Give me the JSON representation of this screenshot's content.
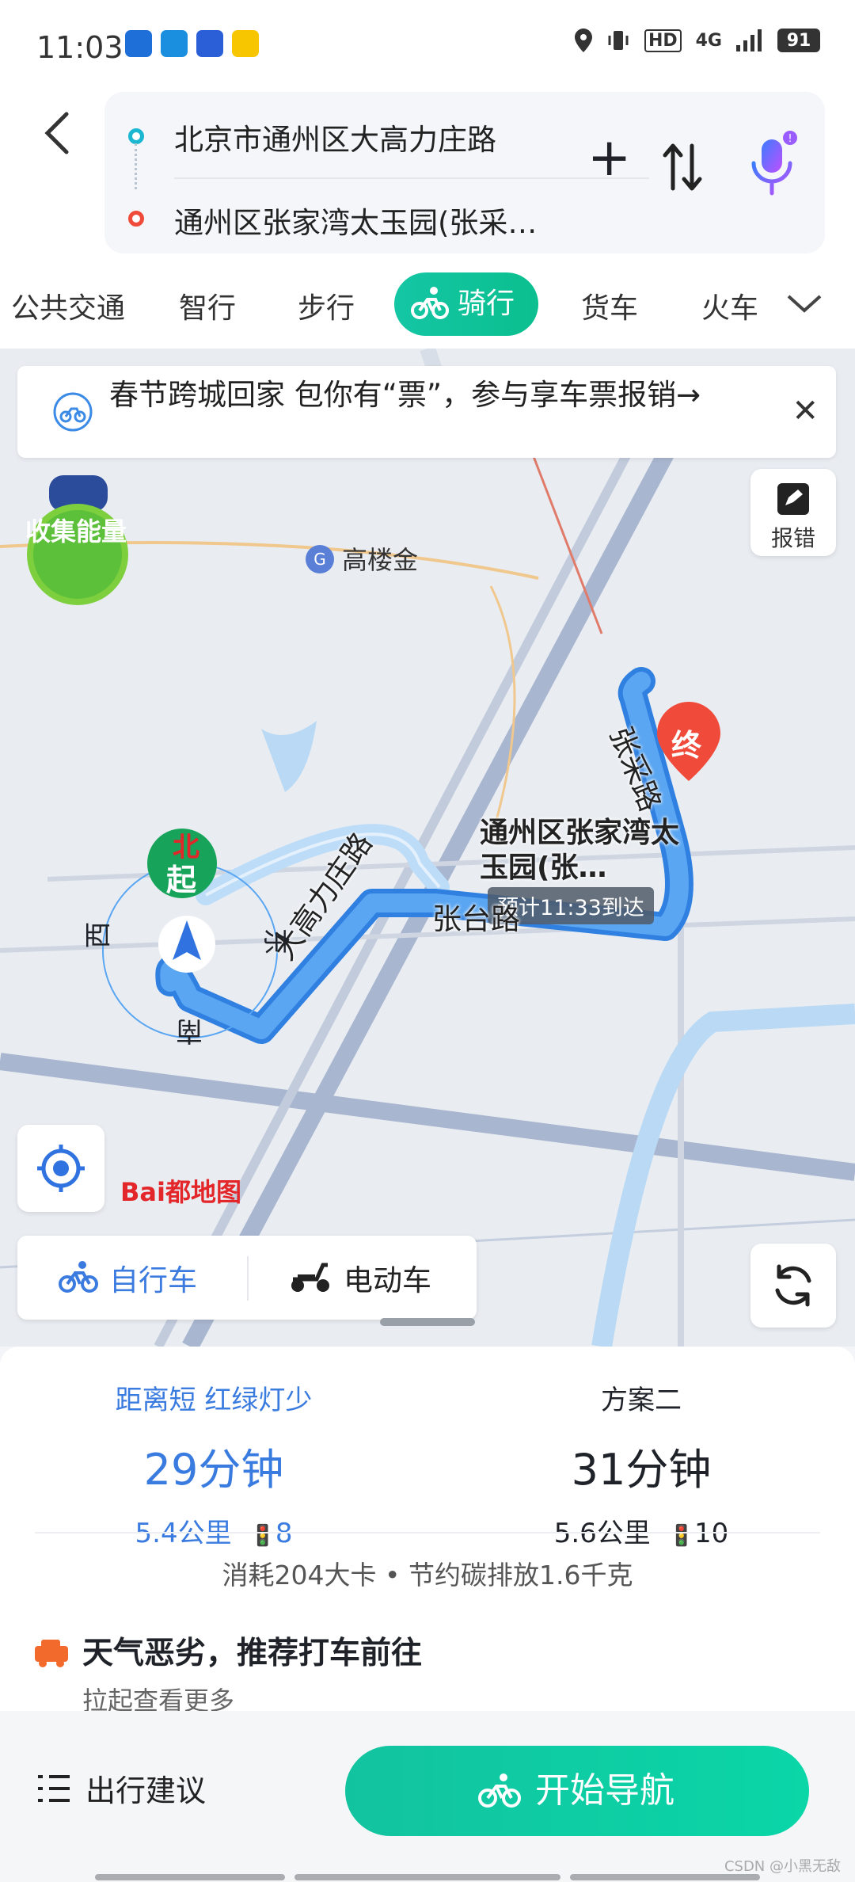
{
  "status_bar": {
    "time": "11:03",
    "battery": "91",
    "network": "4G",
    "hd_badge": "HD"
  },
  "route": {
    "start": "北京市通州区大高力庄路",
    "end": "通州区张家湾太玉园(张采…"
  },
  "tabs": [
    "公共交通",
    "智行",
    "步行",
    "骑行",
    "货车",
    "火车"
  ],
  "map": {
    "banner": "春节跨城回家 包你有“票”，参与享车票报销→",
    "feedback_label": "报错",
    "energy_label": "收集能量",
    "poi": "高楼金",
    "destination": "通州区张家湾太玉园(张…",
    "eta": "预计11:33到达",
    "roads": {
      "r1": "大高力庄路",
      "r2": "张台路",
      "r3": "张采路"
    },
    "compass": {
      "north": "北",
      "south": "南",
      "east": "东",
      "west": "西",
      "start": "起",
      "end": "终"
    },
    "logo": "Bai都地图"
  },
  "mode": {
    "bike": "自行车",
    "ebike": "电动车"
  },
  "plans": [
    {
      "title": "距离短 红绿灯少",
      "time": "29分钟",
      "distance": "5.4公里",
      "lights": "8"
    },
    {
      "title": "方案二",
      "time": "31分钟",
      "distance": "5.6公里",
      "lights": "10"
    }
  ],
  "stats": "消耗204大卡 • 节约碳排放1.6千克",
  "weather": {
    "title": "天气恶劣，推荐打车前往",
    "sub": "拉起查看更多"
  },
  "bottom": {
    "advice": "出行建议",
    "start_nav": "开始导航"
  },
  "watermark": "CSDN @小黑无敌",
  "colors": {
    "accent": "#0bbf8f",
    "route": "#3d8fe6",
    "plan_selected": "#3a7be0",
    "end_marker": "#f04a3a"
  }
}
